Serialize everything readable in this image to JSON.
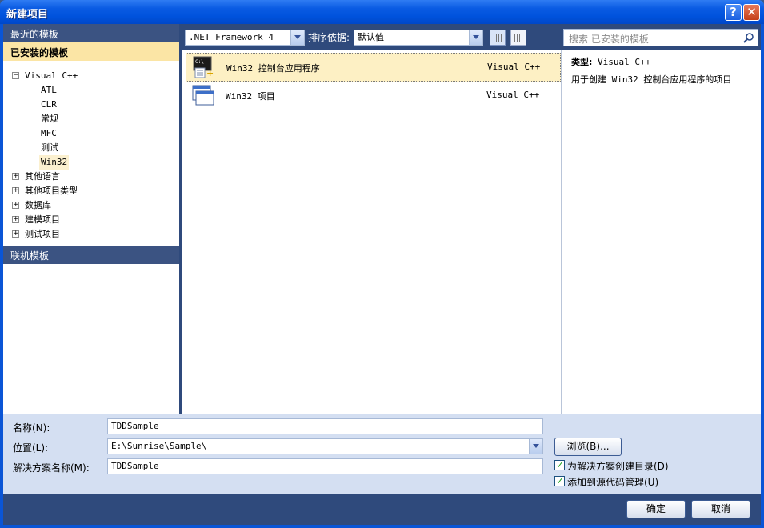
{
  "window": {
    "title": "新建项目",
    "help_glyph": "?",
    "close_glyph": "✕"
  },
  "left_panel": {
    "recent_templates": "最近的模板",
    "installed_templates": "已安装的模板",
    "online_templates": "联机模板",
    "tree": [
      {
        "toggle": "⊟",
        "label": "Visual C++"
      },
      {
        "label": "ATL"
      },
      {
        "label": "CLR"
      },
      {
        "label": "常规"
      },
      {
        "label": "MFC"
      },
      {
        "label": "测试"
      },
      {
        "label": "Win32",
        "selected": true
      },
      {
        "toggle": "⊞",
        "label": "其他语言"
      },
      {
        "toggle": "⊞",
        "label": "其他项目类型"
      },
      {
        "toggle": "⊞",
        "label": "数据库"
      },
      {
        "toggle": "⊞",
        "label": "建模项目"
      },
      {
        "toggle": "⊞",
        "label": "测试项目"
      }
    ]
  },
  "toolbar": {
    "framework": ".NET Framework 4",
    "sort_label": "排序依据:",
    "sort_value": "默认值"
  },
  "search": {
    "placeholder": "搜索 已安装的模板"
  },
  "templates": [
    {
      "name": "Win32 控制台应用程序",
      "lang": "Visual C++",
      "selected": true
    },
    {
      "name": "Win32 项目",
      "lang": "Visual C++",
      "selected": false
    }
  ],
  "details": {
    "type_label": "类型:",
    "type_value": "Visual C++",
    "description": "用于创建 Win32 控制台应用程序的项目"
  },
  "form": {
    "name_label": "名称(N):",
    "name_value": "TDDSample",
    "location_label": "位置(L):",
    "location_value": "E:\\Sunrise\\Sample\\",
    "solution_label": "解决方案名称(M):",
    "solution_value": "TDDSample",
    "browse_label": "浏览(B)...",
    "create_dir_label": "为解决方案创建目录(D)",
    "create_dir_checked": true,
    "source_control_label": "添加到源代码管理(U)",
    "source_control_checked": true
  },
  "buttons": {
    "ok": "确定",
    "cancel": "取消"
  },
  "colors": {
    "title_bar": "#0a5be3",
    "selection": "#fbe5a5",
    "accent": "#3b5382"
  }
}
